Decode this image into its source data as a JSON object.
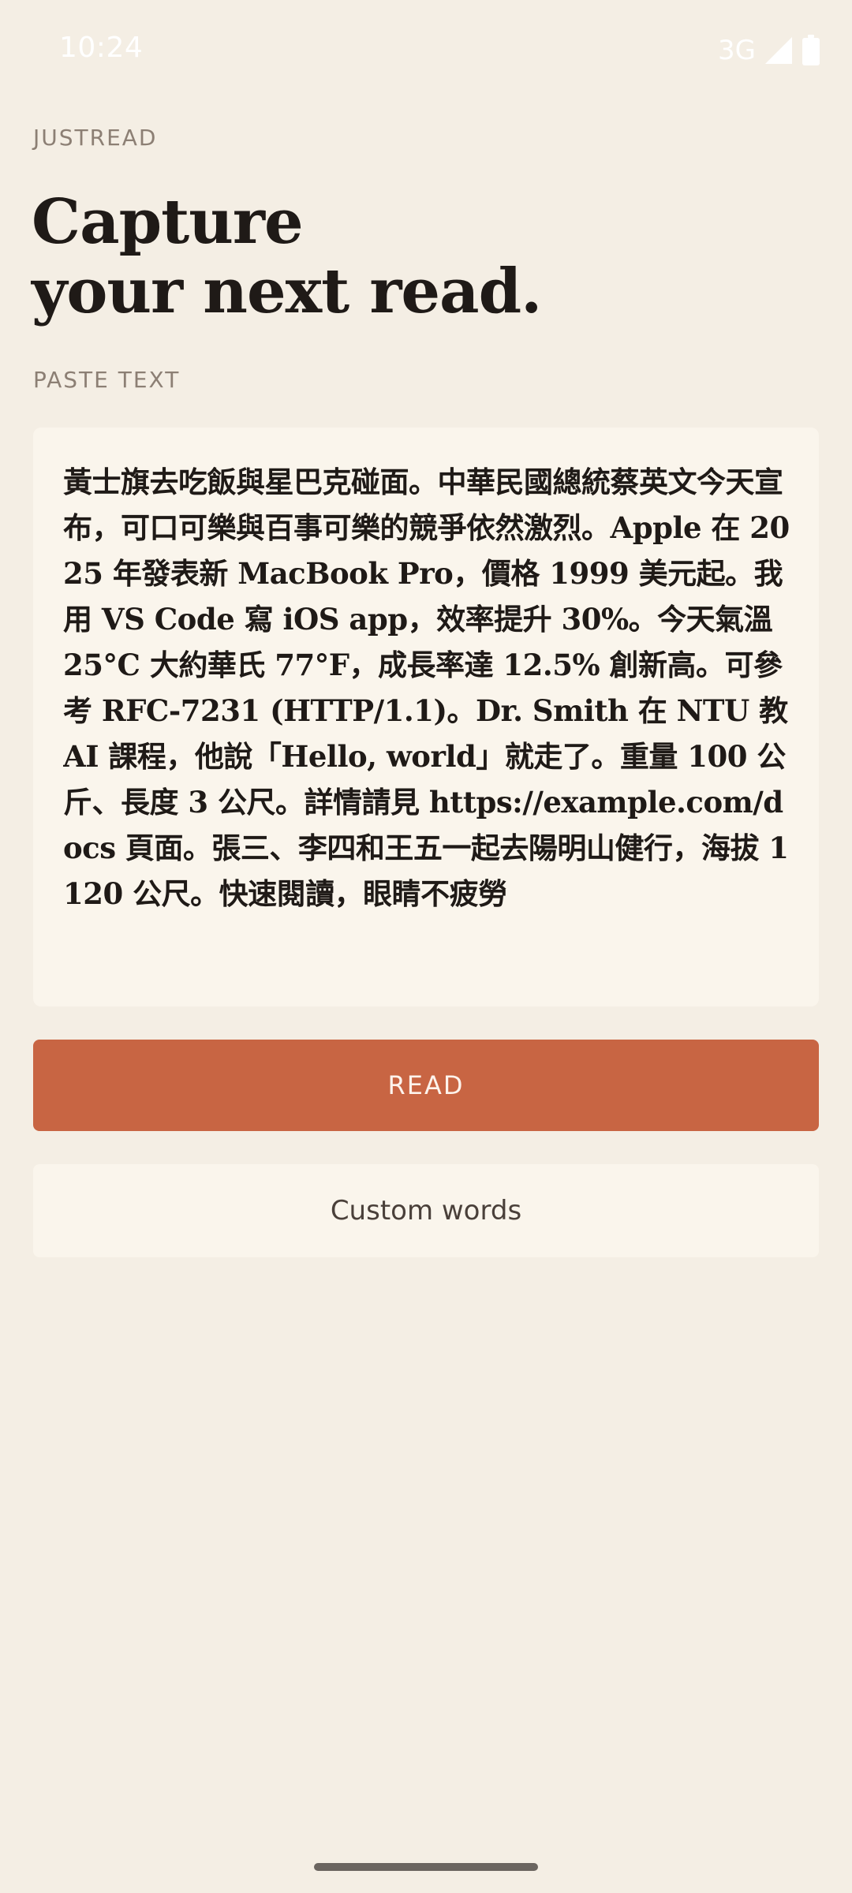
{
  "status_bar": {
    "time": "10:24",
    "network": "3G",
    "icons": [
      "signal-icon",
      "battery-icon"
    ]
  },
  "brand": "JUSTREAD",
  "headline": {
    "line1": "Capture",
    "line2": "your next read."
  },
  "paste_section": {
    "label": "PASTE TEXT",
    "text": "黃士旗去吃飯與星巴克碰面。中華民國總統蔡英文今天宣布，可口可樂與百事可樂的競爭依然激烈。Apple 在 2025 年發表新 MacBook Pro，價格 1999 美元起。我用 VS Code 寫 iOS app，效率提升 30%。今天氣溫 25°C 大約華氏 77°F，成長率達 12.5% 創新高。可參考 RFC-7231 (HTTP/1.1)。Dr. Smith 在 NTU 教 AI 課程，他說「Hello, world」就走了。重量 100 公斤、長度 3 公尺。詳情請見 https://example.com/docs 頁面。張三、李四和王五一起去陽明山健行，海拔 1120 公尺。快速閱讀，眼睛不疲勞"
  },
  "buttons": {
    "read": "READ",
    "custom_words": "Custom words"
  },
  "colors": {
    "background": "#f4eee4",
    "surface": "#faf5ec",
    "accent": "#c86543",
    "text": "#1f1a17",
    "muted": "#8c7f74"
  }
}
